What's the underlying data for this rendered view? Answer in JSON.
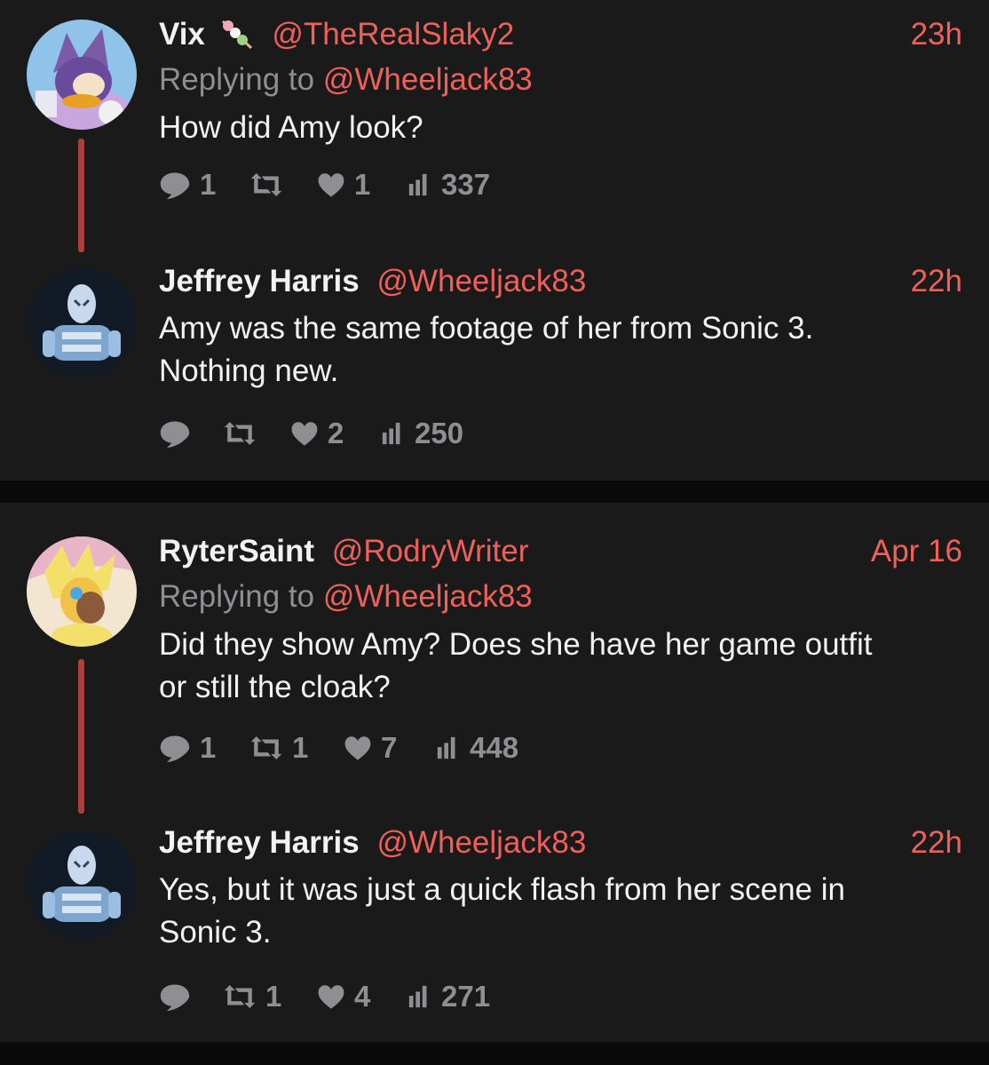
{
  "colors": {
    "background": "#1a1a1a",
    "separator": "#0a0a0a",
    "accent": "#f0605a",
    "text": "#f2f2f2",
    "muted": "#8e8e93",
    "thread_line": "#a84040"
  },
  "threads": [
    {
      "tweets": [
        {
          "name": "Vix",
          "name_icon": "dango-emoji-icon",
          "handle": "@TheRealSlaky2",
          "time": "23h",
          "replying_prefix": "Replying to",
          "replying_to": "@Wheeljack83",
          "text": "How did Amy look?",
          "replies": "1",
          "retweets": "",
          "likes": "1",
          "views": "337"
        },
        {
          "name": "Jeffrey Harris",
          "handle": "@Wheeljack83",
          "time": "22h",
          "text_lines": [
            "Amy was the same footage of her from Sonic 3.",
            "Nothing new."
          ],
          "replies": "",
          "retweets": "",
          "likes": "2",
          "views": "250"
        }
      ]
    },
    {
      "tweets": [
        {
          "name": "RyterSaint",
          "handle": "@RodryWriter",
          "time": "Apr 16",
          "replying_prefix": "Replying to",
          "replying_to": "@Wheeljack83",
          "text_lines": [
            "Did they show Amy? Does she have her game outfit",
            "or still the cloak?"
          ],
          "replies": "1",
          "retweets": "1",
          "likes": "7",
          "views": "448"
        },
        {
          "name": "Jeffrey Harris",
          "handle": "@Wheeljack83",
          "time": "22h",
          "text_lines": [
            "Yes, but it was just a quick flash from her scene in",
            "Sonic 3."
          ],
          "replies": "",
          "retweets": "1",
          "likes": "4",
          "views": "271"
        }
      ]
    }
  ]
}
